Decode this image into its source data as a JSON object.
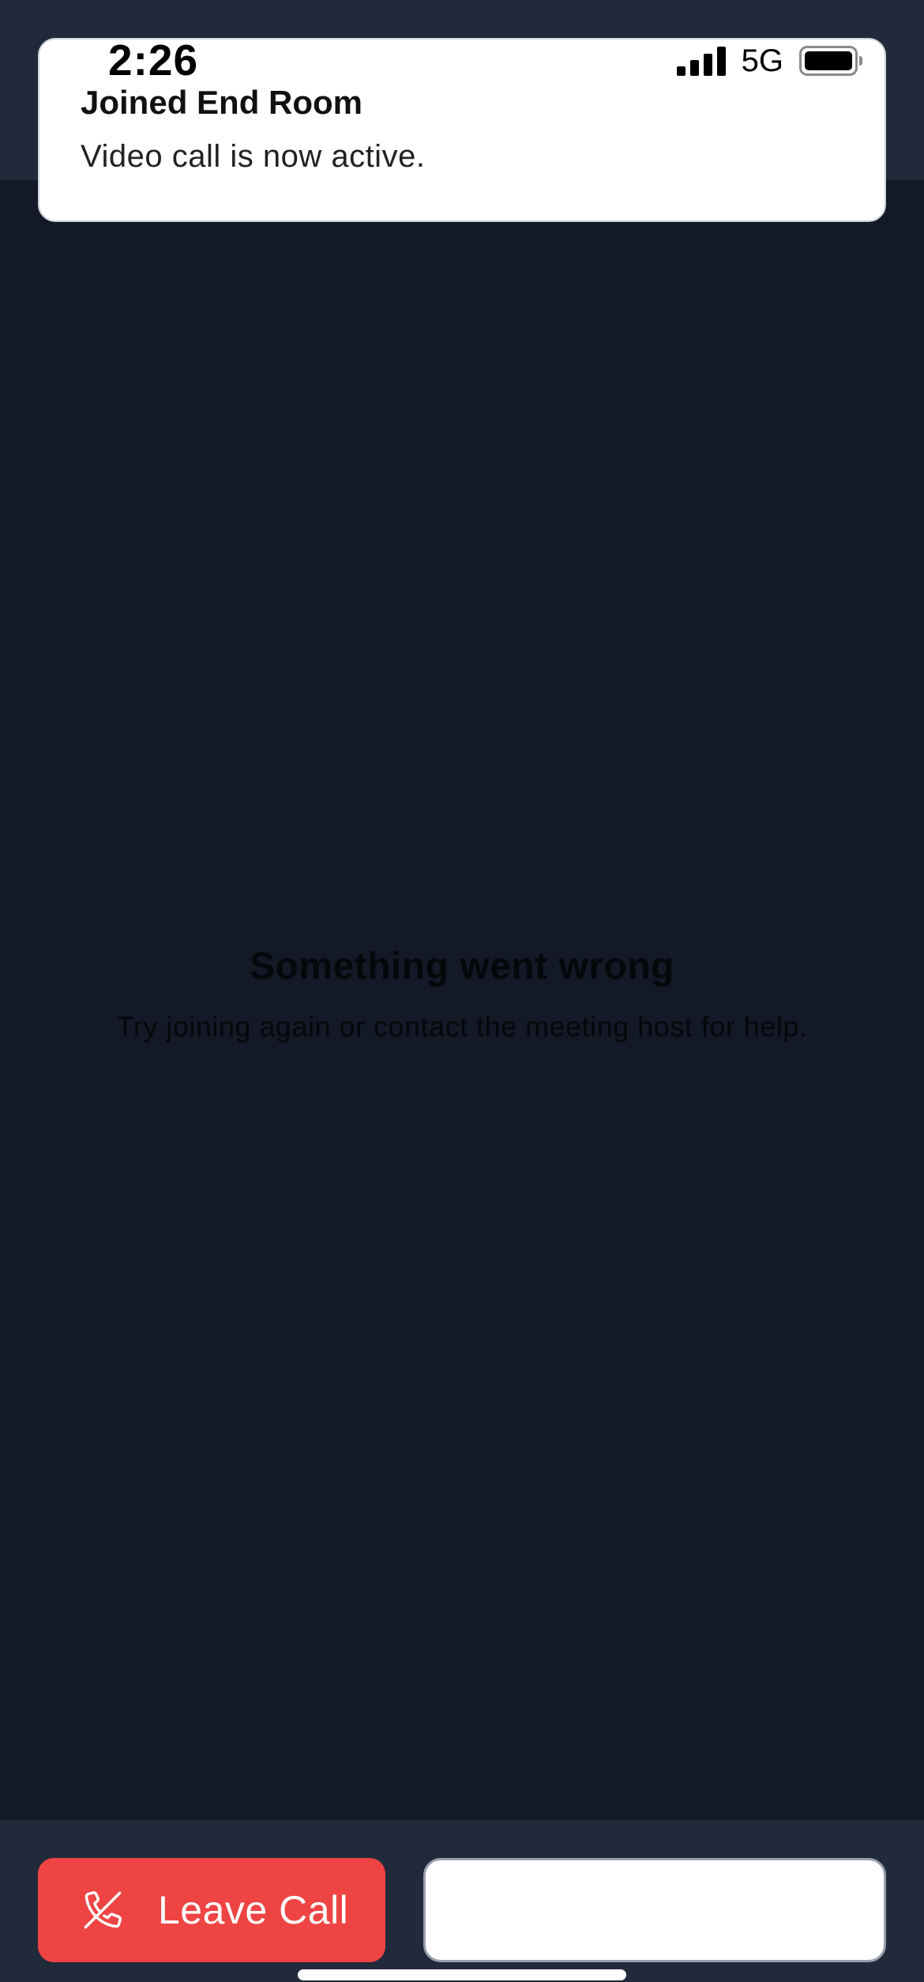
{
  "status_bar": {
    "time": "2:26",
    "network": "5G",
    "signal_icon": "cellular-signal-icon",
    "battery_icon": "battery-full-icon"
  },
  "toast": {
    "title": "Joined End Room",
    "message": "Video call is now active."
  },
  "error": {
    "title": "Something went wrong",
    "message": "Try joining again or contact the meeting host for help."
  },
  "bottom_bar": {
    "leave_label": "Leave Call",
    "leave_icon": "phone-hangup-icon",
    "secondary_label": ""
  },
  "colors": {
    "background": "#131926",
    "header": "#212a3a",
    "leave_button": "#ef4444",
    "toast": "#ffffff"
  }
}
